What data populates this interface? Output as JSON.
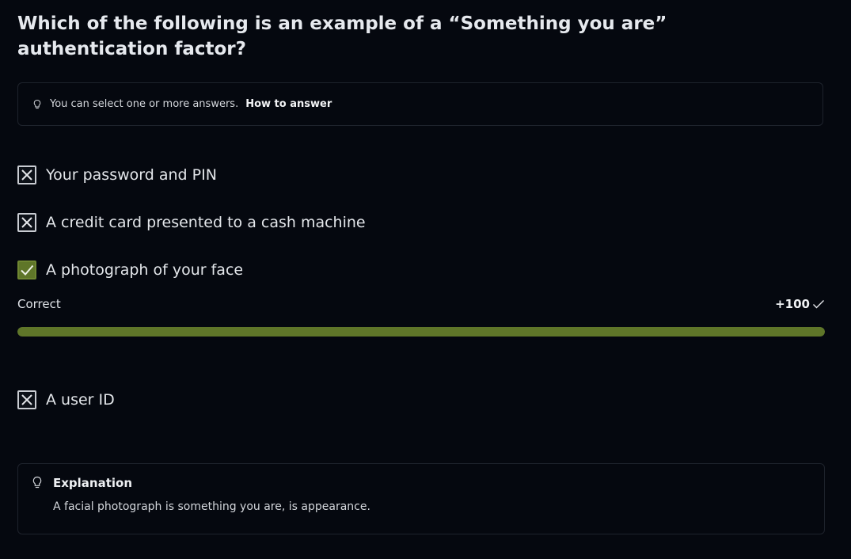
{
  "question": {
    "text": "Which of the following is an example of a “Something you are” authentication factor?"
  },
  "hint": {
    "icon": "lightbulb-icon",
    "text": "You can select one or more answers.",
    "link": "How to answer"
  },
  "options": [
    {
      "label": "Your password and PIN",
      "state": "incorrect",
      "icon": "x-icon"
    },
    {
      "label": "A credit card presented to a cash machine",
      "state": "incorrect",
      "icon": "x-icon"
    },
    {
      "label": "A photograph of your face",
      "state": "correct",
      "icon": "check-icon"
    },
    {
      "label": "A user ID",
      "state": "incorrect",
      "icon": "x-icon"
    }
  ],
  "result": {
    "status": "Correct",
    "points": "+100",
    "progress_fraction": 1.0,
    "color": "#5f7629"
  },
  "explanation": {
    "icon": "lightbulb-icon",
    "title": "Explanation",
    "text": "A facial photograph is something you are, is appearance."
  }
}
